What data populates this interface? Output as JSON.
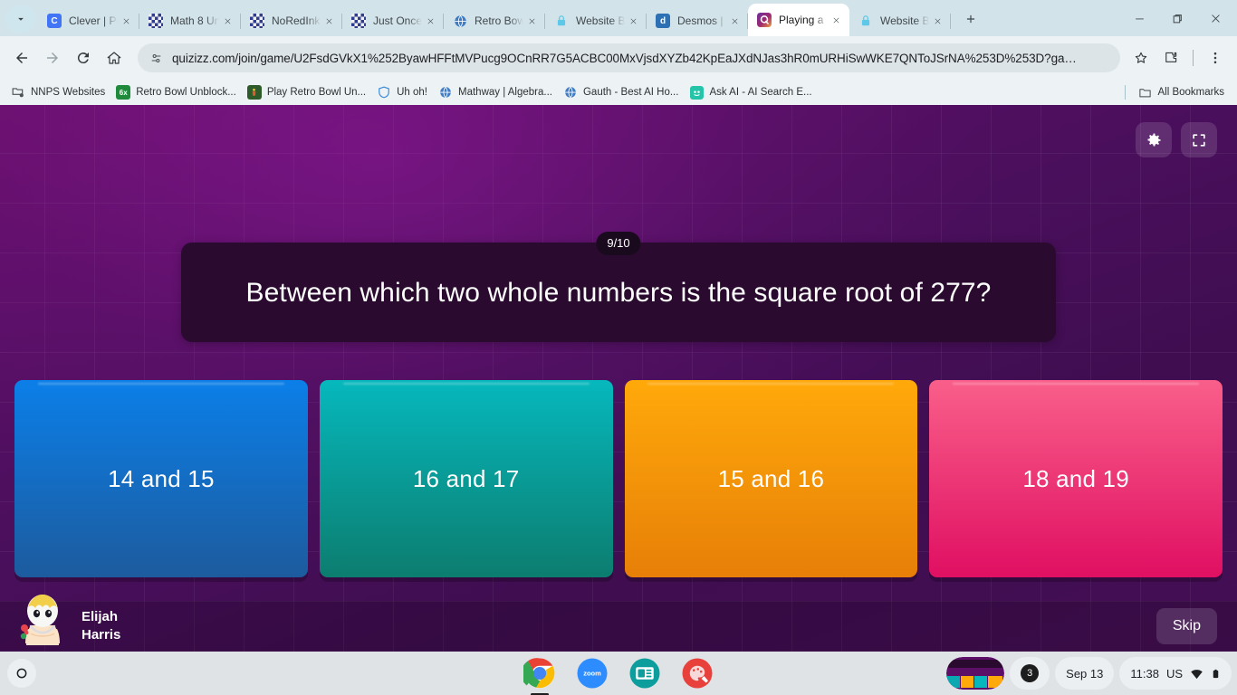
{
  "browser": {
    "tabs": [
      {
        "title": "Clever | Po",
        "favicon": "clever-icon",
        "favicon_color": "#4274f6",
        "favicon_glyph": "C",
        "active": false
      },
      {
        "title": "Math 8 Un",
        "favicon": "checkerboard-icon",
        "favicon_color": "#3b4ea8",
        "favicon_glyph": "",
        "active": false
      },
      {
        "title": "NoRedInk:",
        "favicon": "checkerboard-icon",
        "favicon_color": "#3b4ea8",
        "favicon_glyph": "",
        "active": false
      },
      {
        "title": "Just Once",
        "favicon": "checkerboard-icon",
        "favicon_color": "#3b4ea8",
        "favicon_glyph": "",
        "active": false
      },
      {
        "title": "Retro Bowl",
        "favicon": "globe-icon",
        "favicon_color": "#3f7cc4",
        "favicon_glyph": "",
        "active": false
      },
      {
        "title": "Website Bl",
        "favicon": "lock-icon",
        "favicon_color": "#5ec8e8",
        "favicon_glyph": "",
        "active": false
      },
      {
        "title": "Desmos | ",
        "favicon": "desmos-icon",
        "favicon_color": "#2d70b3",
        "favicon_glyph": "d",
        "active": false
      },
      {
        "title": "Playing a ",
        "favicon": "quizizz-icon",
        "favicon_color": "#8854c0",
        "favicon_glyph": "Q",
        "active": true
      },
      {
        "title": "Website Bl",
        "favicon": "lock-icon",
        "favicon_color": "#5ec8e8",
        "favicon_glyph": "",
        "active": false
      }
    ],
    "new_tab_label": "New tab",
    "window_controls": {
      "minimize": "minimize-button",
      "maximize": "maximize-button",
      "close": "close-button"
    },
    "toolbar": {
      "back_label": "Back",
      "forward_label": "Forward",
      "reload_label": "Reload",
      "home_label": "Home",
      "url": "quizizz.com/join/game/U2FsdGVkX1%252ByawHFFtMVPucg9OCnRR7G5ACBC00MxVjsdXYZb42KpEaJXdNJas3hR0mURHiSwWKE7QNToJSrNA%253D%253D?ga…",
      "bookmark_label": "Bookmark this tab",
      "extensions_label": "Extensions",
      "menu_label": "Customize and control Google Chrome"
    },
    "bookmarks": [
      {
        "label": "NNPS Websites",
        "icon": "folder-settings-icon",
        "color": "#4b5357"
      },
      {
        "label": "Retro Bowl Unblock...",
        "icon": "6x-icon",
        "color": "#1f8a3c"
      },
      {
        "label": "Play Retro Bowl Un...",
        "icon": "player-icon",
        "color": "#2e5b2a"
      },
      {
        "label": "Uh oh!",
        "icon": "shield-icon",
        "color": "#3b8ad9"
      },
      {
        "label": "Mathway | Algebra...",
        "icon": "globe-icon",
        "color": "#3f7cc4"
      },
      {
        "label": "Gauth - Best AI Ho...",
        "icon": "globe-icon",
        "color": "#3f7cc4"
      },
      {
        "label": "Ask AI - AI Search E...",
        "icon": "askai-icon",
        "color": "#23c4a8"
      }
    ],
    "all_bookmarks_label": "All Bookmarks"
  },
  "quiz": {
    "settings_label": "Settings",
    "fullscreen_label": "Fullscreen",
    "question_counter": "9/10",
    "question": "Between which two whole numbers is the square root of 277?",
    "answers": [
      {
        "label": "14 and 15",
        "color_top": "#0b7fe8",
        "color_bottom": "#1d5b9e"
      },
      {
        "label": "16 and 17",
        "color_top": "#06b8bd",
        "color_bottom": "#0c7d6f"
      },
      {
        "label": "15 and 16",
        "color_top": "#ffa90a",
        "color_bottom": "#e77f08"
      },
      {
        "label": "18 and 19",
        "color_top": "#f95f8a",
        "color_bottom": "#e00f62"
      }
    ],
    "player_first_name": "Elijah",
    "player_last_name": "Harris",
    "avatar_label": "player-avatar",
    "skip_label": "Skip"
  },
  "shelf": {
    "launcher_label": "Launcher",
    "apps": [
      {
        "name": "chrome-app-icon",
        "label": "Google Chrome",
        "running": true
      },
      {
        "name": "zoom-app-icon",
        "label": "zoom",
        "running": false
      },
      {
        "name": "screencast-app-icon",
        "label": "Screencast",
        "running": false
      },
      {
        "name": "canvas-app-icon",
        "label": "Canvas",
        "running": false
      }
    ],
    "window_preview_label": "Window preview",
    "notification_count": "3",
    "date": "Sep 13",
    "time": "11:38",
    "locale": "US",
    "wifi_label": "Wi-Fi",
    "battery_label": "Battery"
  }
}
